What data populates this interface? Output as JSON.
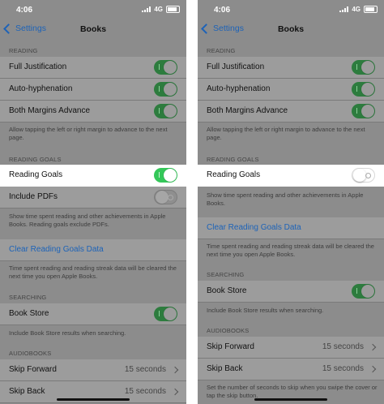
{
  "status": {
    "time": "4:06",
    "network": "4G"
  },
  "nav": {
    "back": "Settings",
    "title": "Books"
  },
  "left": {
    "reading_header": "READING",
    "full_justification": "Full Justification",
    "auto_hyphenation": "Auto-hyphenation",
    "both_margins": "Both Margins Advance",
    "margins_footer": "Allow tapping the left or right margin to advance to the next page.",
    "goals_header": "READING GOALS",
    "reading_goals": "Reading Goals",
    "include_pdfs": "Include PDFs",
    "goals_footer": "Show time spent reading and other achievements in Apple Books. Reading goals exclude PDFs.",
    "clear_goals": "Clear Reading Goals Data",
    "clear_footer": "Time spent reading and reading streak data will be cleared the next time you open Apple Books.",
    "searching_header": "SEARCHING",
    "book_store": "Book Store",
    "book_store_footer": "Include Book Store results when searching.",
    "audiobooks_header": "AUDIOBOOKS",
    "skip_forward": "Skip Forward",
    "skip_forward_value": "15 seconds",
    "skip_back": "Skip Back",
    "skip_back_value": "15 seconds"
  },
  "right": {
    "reading_header": "READING",
    "full_justification": "Full Justification",
    "auto_hyphenation": "Auto-hyphenation",
    "both_margins": "Both Margins Advance",
    "margins_footer": "Allow tapping the left or right margin to advance to the next page.",
    "goals_header": "READING GOALS",
    "reading_goals": "Reading Goals",
    "goals_footer": "Show time spent reading and other achievements in Apple Books.",
    "clear_goals": "Clear Reading Goals Data",
    "clear_footer": "Time spent reading and reading streak data will be cleared the next time you open Apple Books.",
    "searching_header": "SEARCHING",
    "book_store": "Book Store",
    "book_store_footer": "Include Book Store results when searching.",
    "audiobooks_header": "AUDIOBOOKS",
    "skip_forward": "Skip Forward",
    "skip_forward_value": "15 seconds",
    "skip_back": "Skip Back",
    "skip_back_value": "15 seconds",
    "skip_footer": "Set the number of seconds to skip when you swipe the cover or tap the skip button."
  },
  "toggles": {
    "left": {
      "full_justification": "on",
      "auto_hyphenation": "on",
      "both_margins": "on",
      "reading_goals": "on",
      "include_pdfs": "off",
      "book_store": "on"
    },
    "right": {
      "full_justification": "on",
      "auto_hyphenation": "on",
      "both_margins": "on",
      "reading_goals": "off",
      "book_store": "on"
    }
  },
  "colors": {
    "accent": "#1d63b8",
    "toggle_on": "#34c759",
    "dim_overlay": "#8c8c8c"
  }
}
